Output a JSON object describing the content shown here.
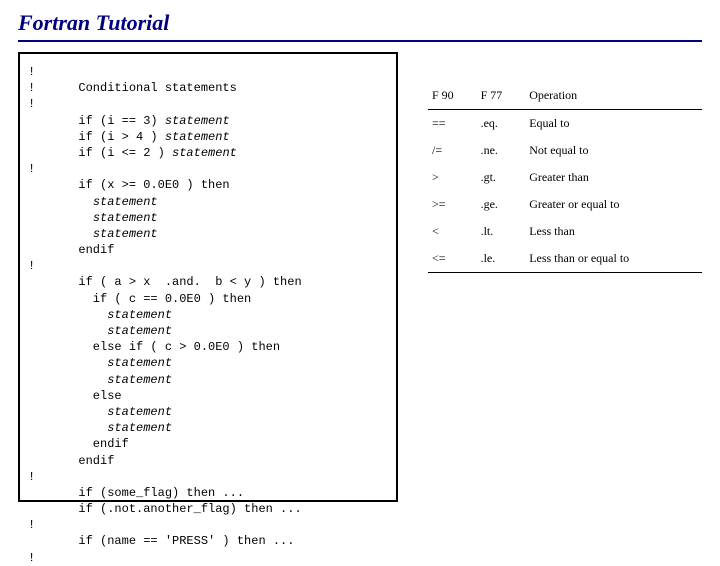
{
  "title": "Fortran Tutorial",
  "code_lines": [
    {
      "t": "!"
    },
    {
      "t": "!      Conditional statements"
    },
    {
      "t": "!"
    },
    {
      "p": "       if (i == 3) ",
      "s": "statement"
    },
    {
      "p": "       if (i > 4 ) ",
      "s": "statement"
    },
    {
      "p": "       if (i <= 2 ) ",
      "s": "statement"
    },
    {
      "t": "!"
    },
    {
      "t": "       if (x >= 0.0E0 ) then"
    },
    {
      "p": "         ",
      "s": "statement"
    },
    {
      "p": "         ",
      "s": "statement"
    },
    {
      "p": "         ",
      "s": "statement"
    },
    {
      "t": "       endif"
    },
    {
      "t": "!"
    },
    {
      "t": "       if ( a > x  .and.  b < y ) then"
    },
    {
      "t": "         if ( c == 0.0E0 ) then"
    },
    {
      "p": "           ",
      "s": "statement"
    },
    {
      "p": "           ",
      "s": "statement"
    },
    {
      "t": "         else if ( c > 0.0E0 ) then"
    },
    {
      "p": "           ",
      "s": "statement"
    },
    {
      "p": "           ",
      "s": "statement"
    },
    {
      "t": "         else"
    },
    {
      "p": "           ",
      "s": "statement"
    },
    {
      "p": "           ",
      "s": "statement"
    },
    {
      "t": "         endif"
    },
    {
      "t": "       endif"
    },
    {
      "t": "!"
    },
    {
      "t": "       if (some_flag) then ..."
    },
    {
      "t": "       if (.not.another_flag) then ..."
    },
    {
      "t": "!"
    },
    {
      "t": "       if (name == 'PRESS' ) then ..."
    },
    {
      "t": "!"
    }
  ],
  "table": {
    "headers": [
      "F 90",
      "F 77",
      "Operation"
    ],
    "rows": [
      [
        "==",
        ".eq.",
        "Equal to"
      ],
      [
        "/=",
        ".ne.",
        "Not equal to"
      ],
      [
        ">",
        ".gt.",
        "Greater than"
      ],
      [
        ">=",
        ".ge.",
        "Greater or equal to"
      ],
      [
        "<",
        ".lt.",
        "Less than"
      ],
      [
        "<=",
        ".le.",
        "Less than or equal to"
      ]
    ]
  }
}
